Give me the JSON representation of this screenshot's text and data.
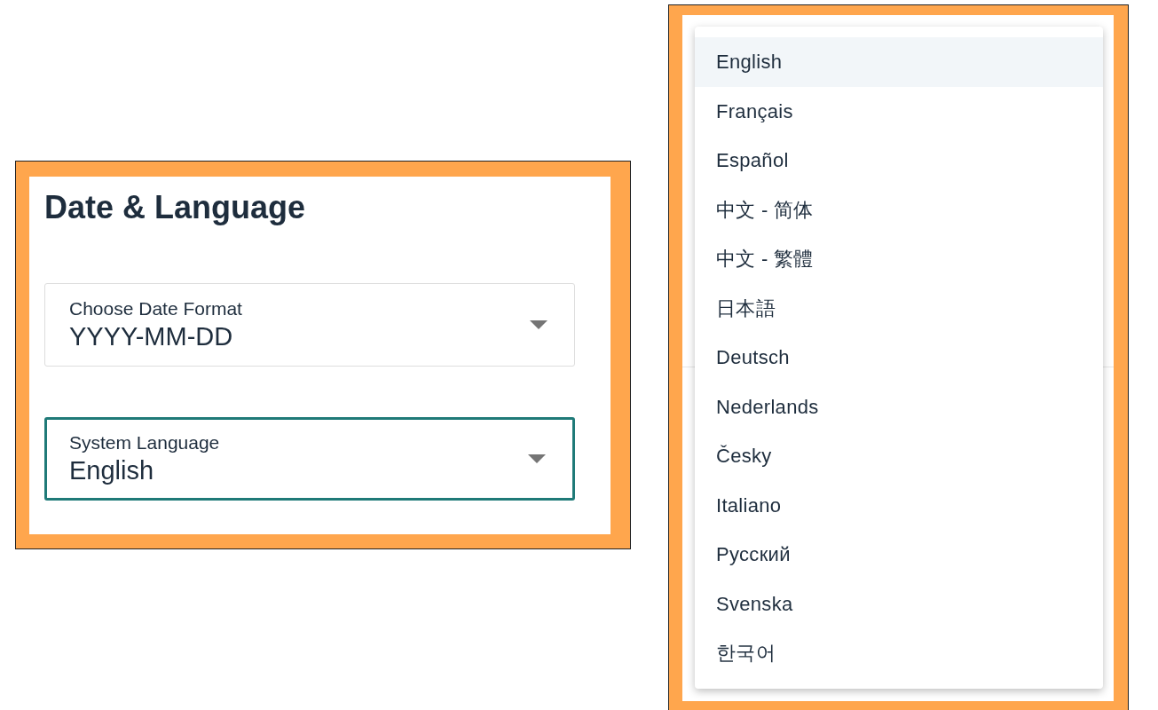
{
  "settings": {
    "title": "Date & Language",
    "fields": [
      {
        "label": "Choose Date Format",
        "value": "YYYY-MM-DD",
        "focused": false
      },
      {
        "label": "System Language",
        "value": "English",
        "focused": true
      }
    ]
  },
  "language_menu": {
    "items": [
      {
        "label": "English",
        "selected": true
      },
      {
        "label": "Français",
        "selected": false
      },
      {
        "label": "Español",
        "selected": false
      },
      {
        "label": "中文 - 简体",
        "selected": false
      },
      {
        "label": "中文 - 繁體",
        "selected": false
      },
      {
        "label": "日本語",
        "selected": false
      },
      {
        "label": "Deutsch",
        "selected": false
      },
      {
        "label": "Nederlands",
        "selected": false
      },
      {
        "label": "Česky",
        "selected": false
      },
      {
        "label": "Italiano",
        "selected": false
      },
      {
        "label": "Русский",
        "selected": false
      },
      {
        "label": "Svenska",
        "selected": false
      },
      {
        "label": "한국어",
        "selected": false
      }
    ]
  }
}
